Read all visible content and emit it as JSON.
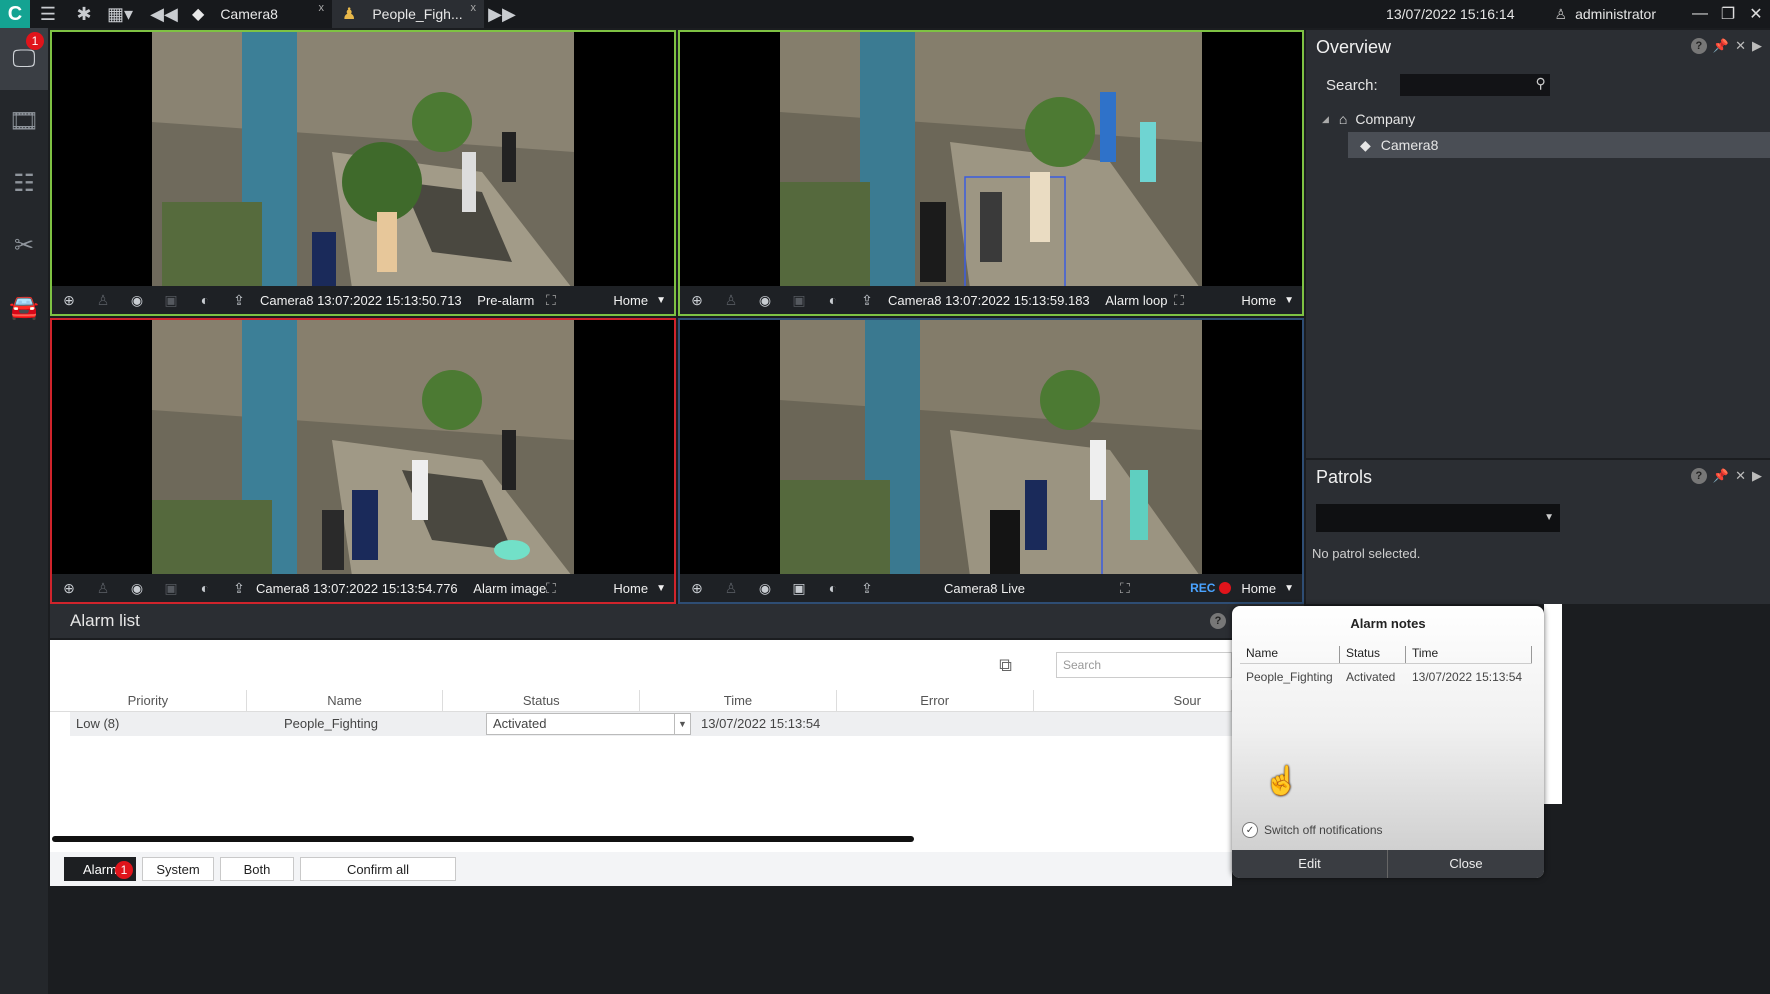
{
  "topbar": {
    "logo": "C",
    "tabs": [
      {
        "label": "Camera8",
        "close": "x"
      },
      {
        "label": "People_Figh...",
        "close": "x"
      }
    ],
    "datetime": "13/07/2022 15:16:14",
    "user": "administrator"
  },
  "sidebar": {
    "badge": "1"
  },
  "tiles": [
    {
      "caption": "Camera8 13:07:2022 15:13:50.713",
      "mode": "Pre-alarm",
      "home": "Home"
    },
    {
      "caption": "Camera8 13:07:2022 15:13:59.183",
      "mode": "Alarm loop",
      "home": "Home"
    },
    {
      "caption": "Camera8 13:07:2022 15:13:54.776",
      "mode": "Alarm image",
      "home": "Home"
    },
    {
      "caption": "Camera8 Live",
      "mode": "",
      "home": "Home",
      "rec": "REC"
    }
  ],
  "overview": {
    "title": "Overview",
    "search_label": "Search:",
    "tree": [
      {
        "label": "Company"
      },
      {
        "label": "Camera8"
      }
    ]
  },
  "patrols": {
    "title": "Patrols",
    "empty": "No patrol selected."
  },
  "alarm_list": {
    "title": "Alarm list",
    "search_placeholder": "Search",
    "columns": [
      "Priority",
      "Name",
      "Status",
      "Time",
      "Error",
      "Sour"
    ],
    "rows": [
      {
        "priority": "Low (8)",
        "name": "People_Fighting",
        "status": "Activated",
        "time": "13/07/2022 15:13:54"
      }
    ],
    "footer": {
      "alarm": "Alarm",
      "alarm_badge": "1",
      "system": "System",
      "both": "Both",
      "confirm_all": "Confirm all"
    }
  },
  "alarm_notes": {
    "title": "Alarm notes",
    "columns": [
      "Name",
      "Status",
      "Time"
    ],
    "row": {
      "name": "People_Fighting",
      "status": "Activated",
      "time": "13/07/2022 15:13:54"
    },
    "switch_off": "Switch off notifications",
    "edit": "Edit",
    "close": "Close"
  }
}
